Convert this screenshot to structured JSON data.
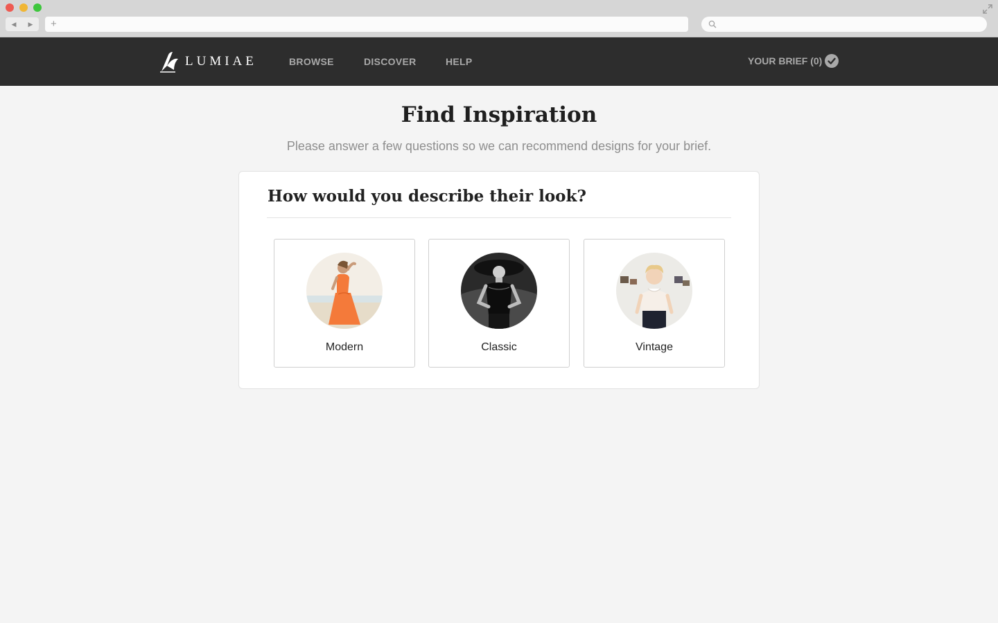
{
  "browser": {
    "new_tab_symbol": "+",
    "back_icon": "back-arrow-icon",
    "forward_icon": "forward-arrow-icon"
  },
  "header": {
    "logo_text": "LUMIAE",
    "nav": [
      {
        "label": "BROWSE"
      },
      {
        "label": "DISCOVER"
      },
      {
        "label": "HELP"
      }
    ],
    "brief_label": "YOUR BRIEF (0)",
    "background_color": "#2d2d2d",
    "link_color": "#a9a9a9"
  },
  "main": {
    "title": "Find Inspiration",
    "subtitle": "Please answer a few questions so we can recommend designs for your brief.",
    "question": "How would you describe their look?",
    "options": [
      {
        "label": "Modern",
        "accent": "#f47a3a"
      },
      {
        "label": "Classic",
        "accent": "#1a1a1a"
      },
      {
        "label": "Vintage",
        "accent": "#e9e6e2"
      }
    ]
  }
}
